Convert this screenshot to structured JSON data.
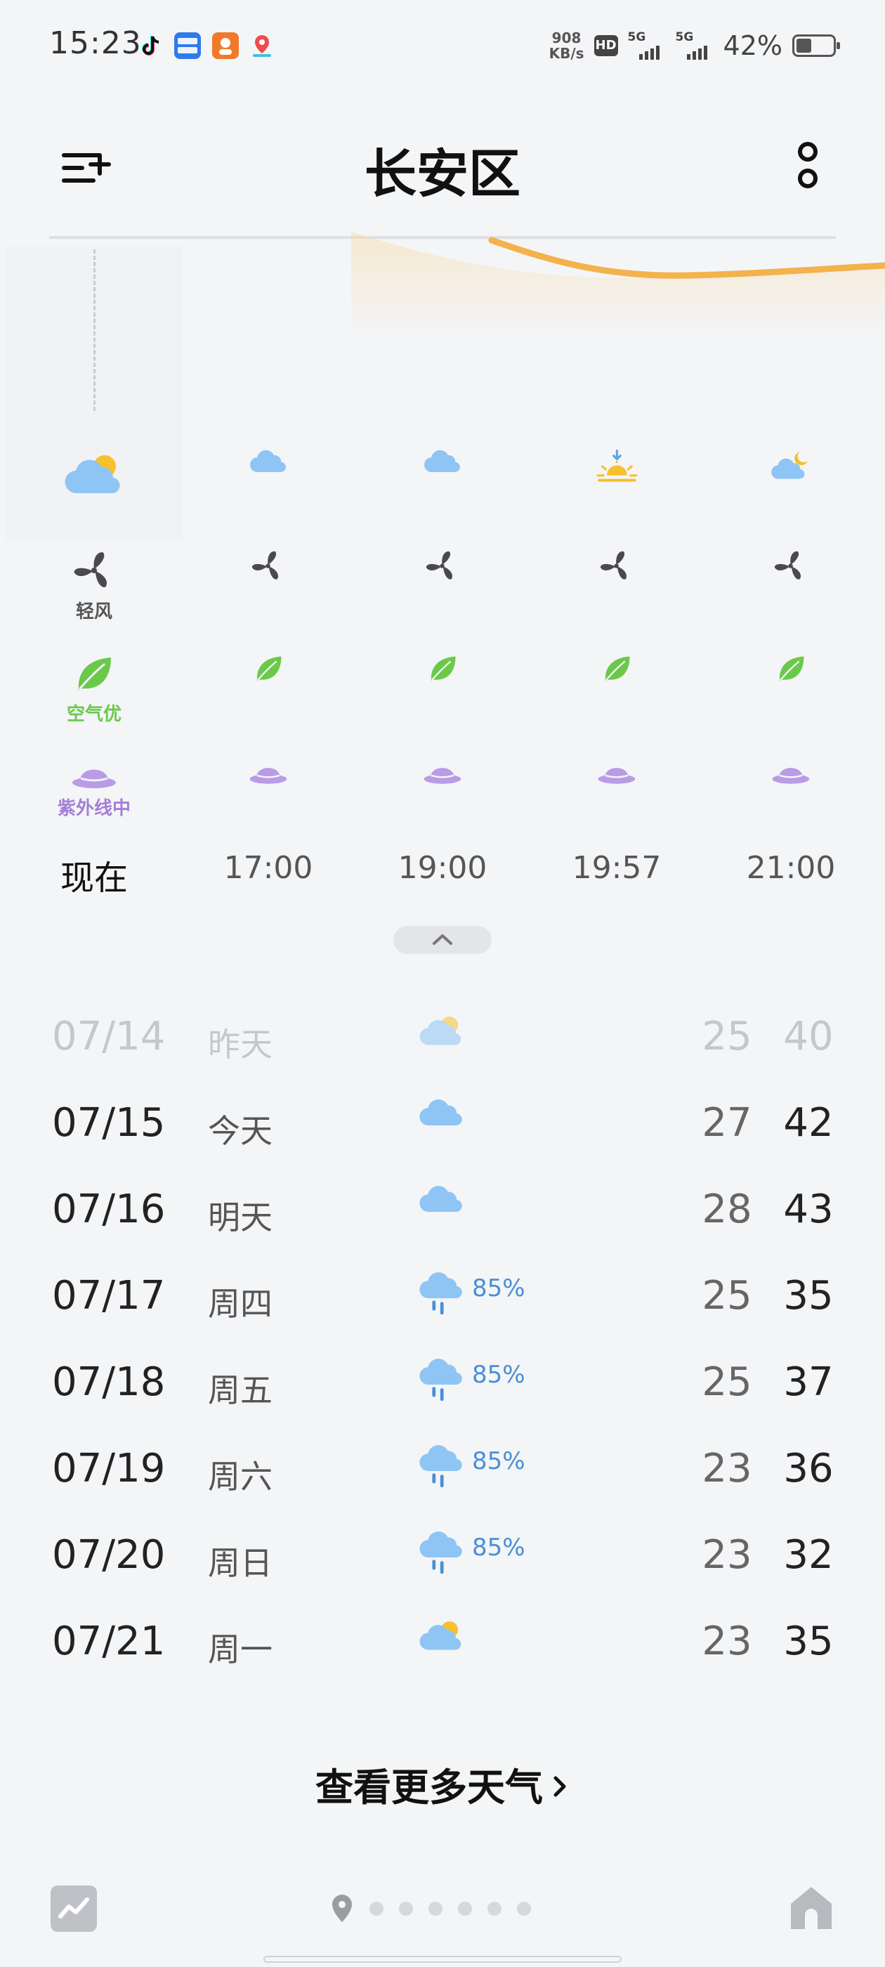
{
  "status_bar": {
    "time": "15:23",
    "net_speed_value": "908",
    "net_speed_unit": "KB/s",
    "hd_label": "HD",
    "sim1_label": "5G",
    "sim2_label": "5G",
    "battery_percent": "42%",
    "battery_level": 0.42,
    "notification_icons": [
      "tiktok-icon",
      "yupao-recruit-icon",
      "app-icon",
      "maps-icon"
    ]
  },
  "header": {
    "title": "长安区",
    "left_icon": "city-list-add-icon",
    "right_icon": "more-icon"
  },
  "hourly": [
    {
      "time": "现在",
      "weather_icon": "partly-cloudy-icon",
      "wind_icon": "fan-icon",
      "wind_label": "轻风",
      "aqi_icon": "leaf-icon",
      "aqi_label": "空气优",
      "uv_icon": "sun-hat-icon",
      "uv_label": "紫外线中"
    },
    {
      "time": "17:00",
      "weather_icon": "cloudy-icon",
      "wind_icon": "fan-icon",
      "aqi_icon": "leaf-icon",
      "uv_icon": "sun-hat-icon"
    },
    {
      "time": "19:00",
      "weather_icon": "cloudy-icon",
      "wind_icon": "fan-icon",
      "aqi_icon": "leaf-icon",
      "uv_icon": "sun-hat-icon"
    },
    {
      "time": "19:57",
      "weather_icon": "sunset-icon",
      "wind_icon": "fan-icon",
      "aqi_icon": "leaf-icon",
      "uv_icon": "sun-hat-icon"
    },
    {
      "time": "21:00",
      "weather_icon": "cloudy-night-icon",
      "wind_icon": "fan-icon",
      "aqi_icon": "leaf-icon",
      "uv_icon": "sun-hat-icon"
    }
  ],
  "daily": [
    {
      "date": "07/14",
      "day": "昨天",
      "icon": "partly-cloudy-icon",
      "precip": "",
      "low": "25",
      "high": "40",
      "past": true
    },
    {
      "date": "07/15",
      "day": "今天",
      "icon": "cloudy-icon",
      "precip": "",
      "low": "27",
      "high": "42"
    },
    {
      "date": "07/16",
      "day": "明天",
      "icon": "cloudy-icon",
      "precip": "",
      "low": "28",
      "high": "43"
    },
    {
      "date": "07/17",
      "day": "周四",
      "icon": "rain-icon",
      "precip": "85%",
      "low": "25",
      "high": "35"
    },
    {
      "date": "07/18",
      "day": "周五",
      "icon": "rain-icon",
      "precip": "85%",
      "low": "25",
      "high": "37"
    },
    {
      "date": "07/19",
      "day": "周六",
      "icon": "rain-icon",
      "precip": "85%",
      "low": "23",
      "high": "36"
    },
    {
      "date": "07/20",
      "day": "周日",
      "icon": "rain-icon",
      "precip": "85%",
      "low": "23",
      "high": "32"
    },
    {
      "date": "07/21",
      "day": "周一",
      "icon": "partly-cloudy-icon",
      "precip": "",
      "low": "23",
      "high": "35"
    }
  ],
  "more_weather_label": "查看更多天气",
  "bottom_bar": {
    "left_icon": "trend-chart-icon",
    "location_icon": "location-pin-icon",
    "page_count": 6,
    "right_icon": "home-icon"
  },
  "colors": {
    "background": "#f4f5f7",
    "cloud": "#8ec5f5",
    "sun": "#f6c12a",
    "leaf": "#6bc94a",
    "uv": "#a47fd6",
    "precip": "#4a8fd6",
    "sun_curve": "#f3b24c"
  }
}
